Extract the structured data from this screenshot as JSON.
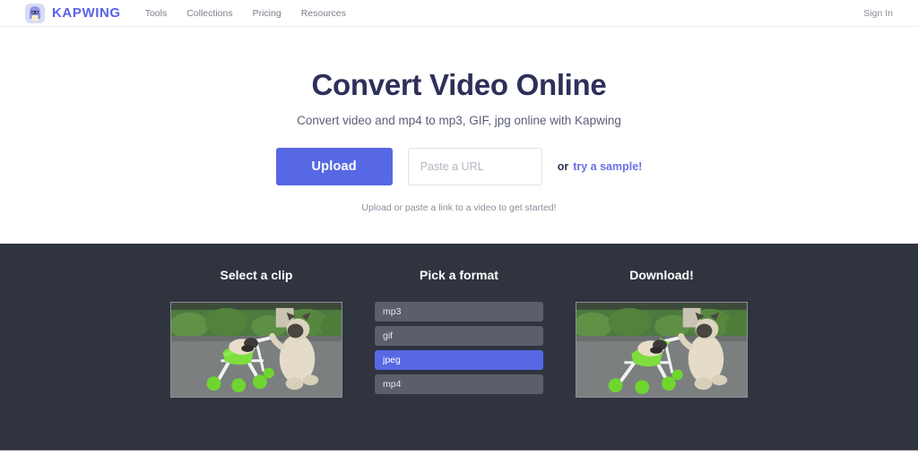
{
  "header": {
    "brand_name": "KAPWING",
    "logo_icon": "kapwing-mascot-icon",
    "nav": [
      {
        "label": "Tools"
      },
      {
        "label": "Collections"
      },
      {
        "label": "Pricing"
      },
      {
        "label": "Resources"
      }
    ],
    "sign_in_label": "Sign In"
  },
  "hero": {
    "title": "Convert Video Online",
    "subtitle": "Convert video and mp4 to mp3, GIF, jpg online with Kapwing",
    "upload_button_label": "Upload",
    "url_placeholder": "Paste a URL",
    "url_value": "",
    "or_label": "or",
    "sample_link_label": "try a sample!",
    "hint": "Upload or paste a link to a video to get started!"
  },
  "steps": [
    {
      "title": "Select a clip",
      "content_type": "video-thumbnail",
      "thumbnail_alt": "pug dog pushing a green and white baby stroller"
    },
    {
      "title": "Pick a format",
      "content_type": "format-list",
      "formats": [
        {
          "label": "mp3",
          "selected": false
        },
        {
          "label": "gif",
          "selected": false
        },
        {
          "label": "jpeg",
          "selected": true
        },
        {
          "label": "mp4",
          "selected": false
        }
      ]
    },
    {
      "title": "Download!",
      "content_type": "video-thumbnail",
      "thumbnail_alt": "pug dog pushing a green and white baby stroller"
    }
  ],
  "colors": {
    "brand_purple": "#5a63e8",
    "accent_button": "#5768e4",
    "heading_navy": "#2d3059",
    "dark_band": "#30343f",
    "format_item": "#5c5f6b",
    "format_selected": "#5768e4",
    "muted_text": "#7c7f8c"
  }
}
